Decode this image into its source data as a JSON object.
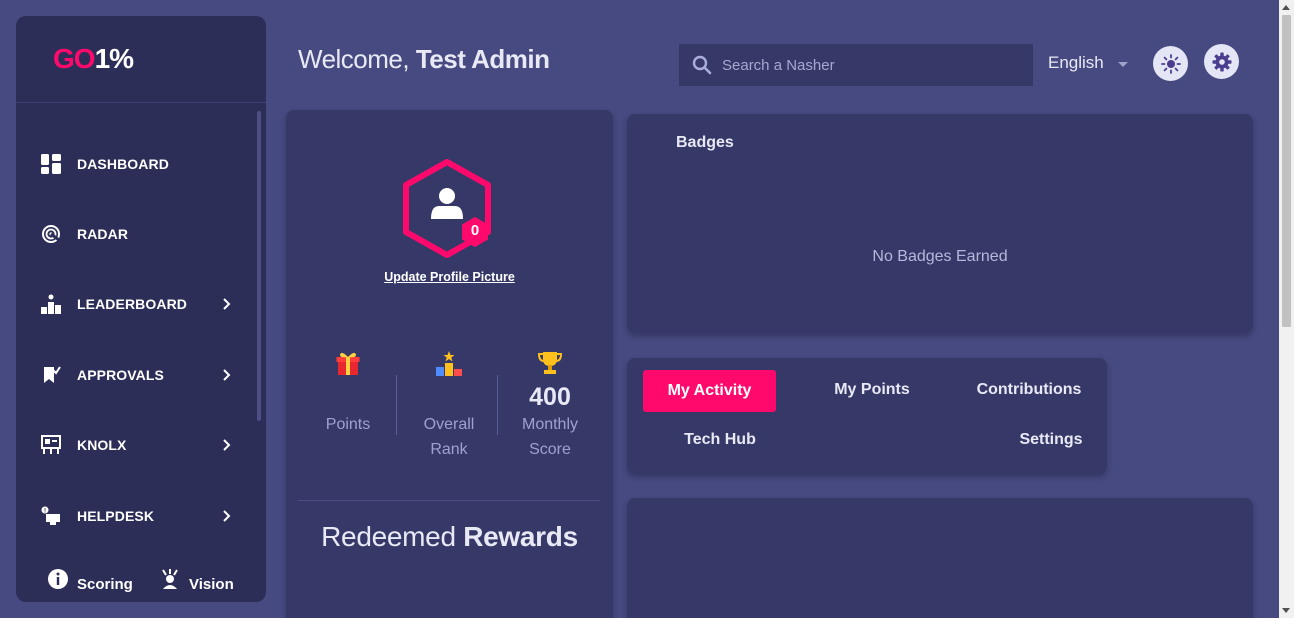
{
  "colors": {
    "background": "#464a80",
    "sidebar": "#2c2e57",
    "card": "#363968",
    "accent": "#ff0a6c",
    "muted_text": "#9ea1d0"
  },
  "brand": {
    "logo_go": "GO",
    "logo_pct": "1%"
  },
  "sidebar": {
    "items": [
      {
        "label": "DASHBOARD",
        "icon": "dashboard-icon",
        "has_submenu": false
      },
      {
        "label": "RADAR",
        "icon": "radar-icon",
        "has_submenu": false
      },
      {
        "label": "LEADERBOARD",
        "icon": "leaderboard-icon",
        "has_submenu": true
      },
      {
        "label": "APPROVALS",
        "icon": "approvals-icon",
        "has_submenu": true
      },
      {
        "label": "KNOLX",
        "icon": "knolx-icon",
        "has_submenu": true
      },
      {
        "label": "HELPDESK",
        "icon": "helpdesk-icon",
        "has_submenu": true
      }
    ],
    "footer": {
      "scoring_label": "Scoring",
      "vision_label": "Vision"
    }
  },
  "header": {
    "welcome_prefix": "Welcome,",
    "user_name": "Test Admin",
    "search_placeholder": "Search a Nasher",
    "language": "English"
  },
  "profile": {
    "level_badge": "0",
    "update_picture_label": "Update Profile Picture",
    "stats": [
      {
        "value": "",
        "label_line1": "Points",
        "label_line2": "",
        "icon": "gift-icon"
      },
      {
        "value": "",
        "label_line1": "Overall",
        "label_line2": "Rank",
        "icon": "podium-icon"
      },
      {
        "value": "400",
        "label_line1": "Monthly",
        "label_line2": "Score",
        "icon": "trophy-icon"
      }
    ],
    "redeemed_prefix": "Redeemed",
    "redeemed_bold": "Rewards"
  },
  "badges": {
    "title": "Badges",
    "empty_message": "No Badges Earned"
  },
  "activity_tabs": {
    "tabs": [
      {
        "label": "My Activity",
        "active": true
      },
      {
        "label": "My Points",
        "active": false
      },
      {
        "label": "Contributions",
        "active": false
      },
      {
        "label": "Tech Hub",
        "active": false
      },
      {
        "label": "Settings",
        "active": false
      }
    ]
  }
}
